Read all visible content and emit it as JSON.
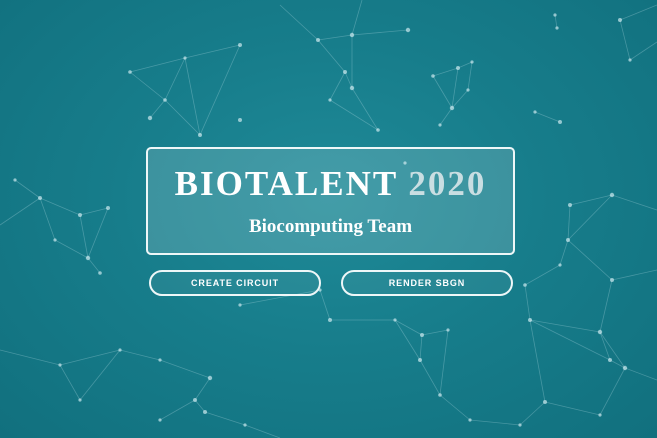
{
  "header": {
    "title_main": "BIOTALENT",
    "title_year": "2020",
    "subtitle": "Biocomputing Team"
  },
  "actions": {
    "create_circuit_label": "CREATE CIRCUIT",
    "render_sbgn_label": "RENDER SBGN"
  },
  "colors": {
    "background": "#177d8b",
    "accent_text": "#ffffff",
    "year_text": "#c9dee2"
  }
}
